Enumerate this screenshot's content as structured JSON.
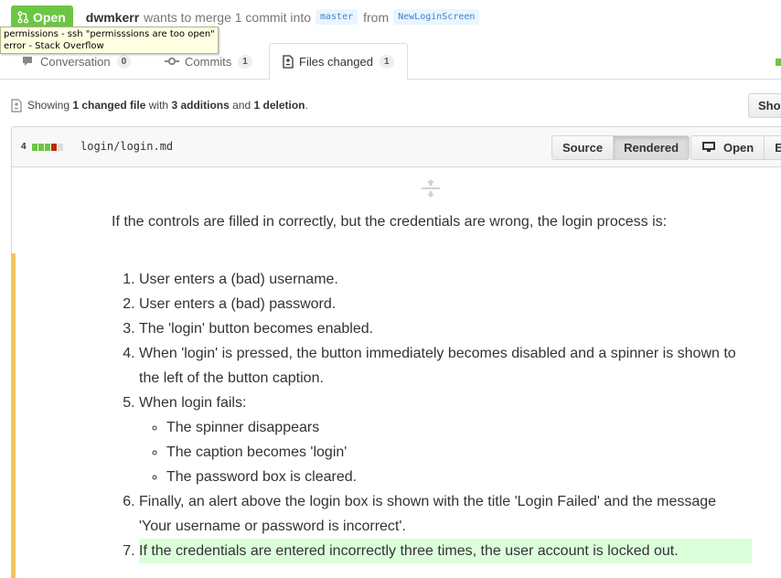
{
  "header": {
    "state": "Open",
    "author": "dwmkerr",
    "merge_text": "wants to merge 1 commit into",
    "base_branch": "master",
    "from_text": "from",
    "head_branch": "NewLoginScreen",
    "state_color": "#6cc644"
  },
  "tooltip": {
    "line1": "permissions - ssh \"permisssions are too open\"",
    "line2": "error - Stack Overflow"
  },
  "tabs": [
    {
      "label": "Conversation",
      "count": "0",
      "icon": "comment-icon"
    },
    {
      "label": "Commits",
      "count": "1",
      "icon": "commit-icon"
    },
    {
      "label": "Files changed",
      "count": "1",
      "icon": "diff-icon",
      "selected": true
    }
  ],
  "toc": {
    "showing": "Showing",
    "changed": "1 changed file",
    "with": "with",
    "additions": "3 additions",
    "and": "and",
    "deletions": "1 deletion",
    "end": ".",
    "show_button": "Sho"
  },
  "file": {
    "diff_count": "4",
    "path": "login/login.md",
    "source_label": "Source",
    "rendered_label": "Rendered",
    "open_label": "Open",
    "edit_label": "Edi"
  },
  "content": {
    "intro": "If the controls are filled in correctly, but the credentials are wrong, the login process is:",
    "steps": [
      "User enters a (bad) username.",
      "User enters a (bad) password.",
      "The 'login' button becomes enabled.",
      "When 'login' is pressed, the button immediately becomes disabled and a spinner is shown to the left of the button caption.",
      "When login fails:",
      "Finally, an alert above the login box is shown with the title 'Login Failed' and the message 'Your username or password is incorrect'.",
      "If the credentials are entered incorrectly three times, the user account is locked out."
    ],
    "sub_steps": [
      "The spinner disappears",
      "The caption becomes 'login'",
      "The password box is cleared."
    ]
  },
  "colors": {
    "added": "#6cc644",
    "deleted": "#bd2c00",
    "neutral": "#dddddd",
    "change_bar": "#f3c65d",
    "added_line": "#dbffdb"
  }
}
